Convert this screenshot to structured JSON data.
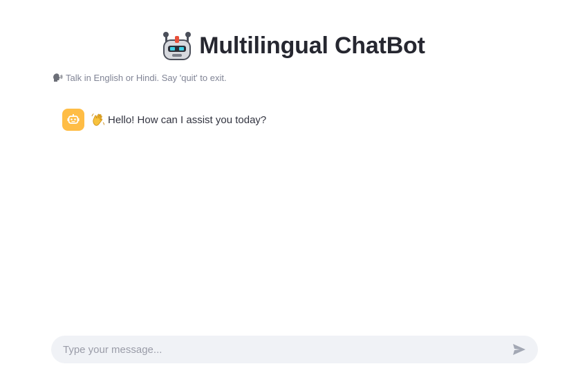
{
  "header": {
    "title": "Multilingual ChatBot",
    "icon": "robot-icon"
  },
  "caption": {
    "icon": "speaking-head-icon",
    "text": "Talk in English or Hindi. Say 'quit' to exit."
  },
  "messages": [
    {
      "role": "assistant",
      "avatar_icon": "bot-face-icon",
      "emoji_icon": "waving-hand-icon",
      "text": "Hello! How can I assist you today?"
    }
  ],
  "chat_input": {
    "placeholder": "Type your message...",
    "value": "",
    "send_icon": "send-icon"
  },
  "colors": {
    "background": "#ffffff",
    "avatar_bg": "#ffbd45",
    "input_bg": "#f0f2f6",
    "title_text": "#262730",
    "caption_text": "#808495"
  }
}
